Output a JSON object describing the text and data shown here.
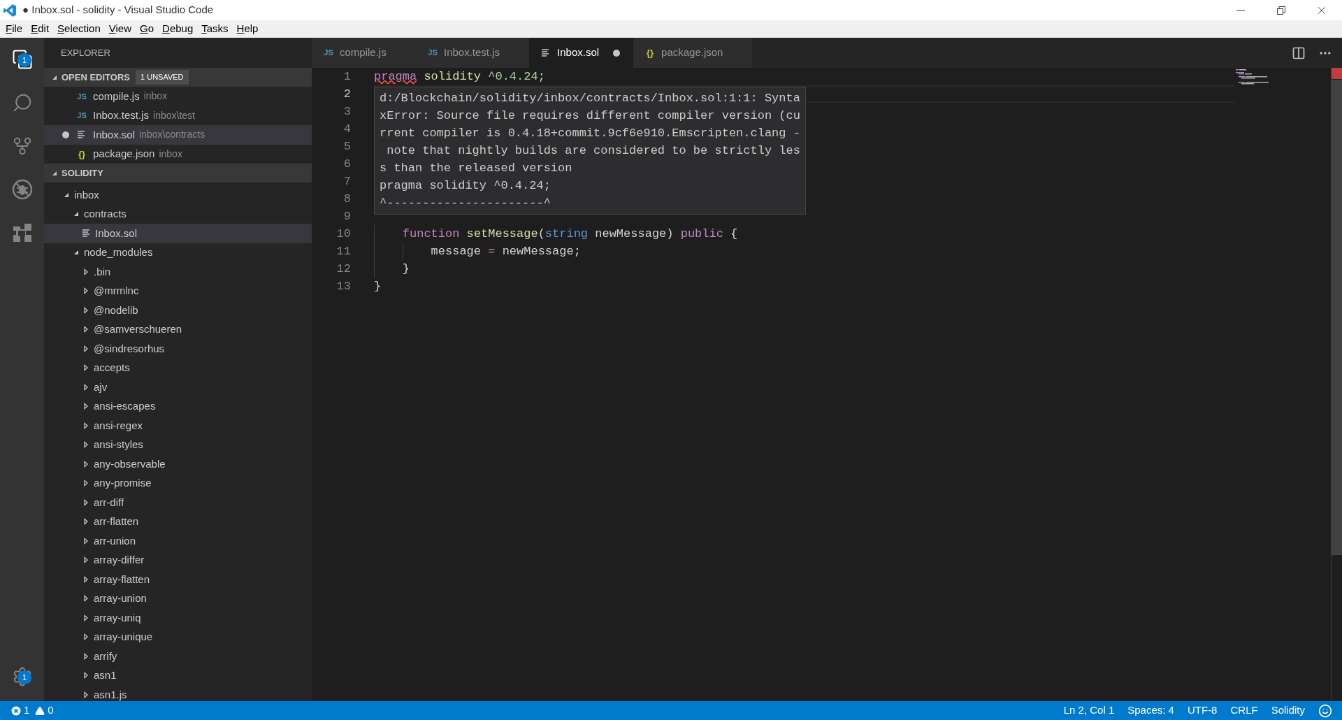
{
  "window": {
    "title": "● Inbox.sol - solidity - Visual Studio Code"
  },
  "menu": [
    "File",
    "Edit",
    "Selection",
    "View",
    "Go",
    "Debug",
    "Tasks",
    "Help"
  ],
  "activity_bar": [
    {
      "kind": "files",
      "selected": true,
      "badge": "1"
    },
    {
      "kind": "search",
      "selected": false
    },
    {
      "kind": "git",
      "selected": false
    },
    {
      "kind": "debug",
      "selected": false
    },
    {
      "kind": "extensions",
      "selected": false
    }
  ],
  "settings": {
    "badge": "1"
  },
  "sidebar": {
    "title": "EXPLORER",
    "open_editors": {
      "title": "OPEN EDITORS",
      "badge": "1 UNSAVED",
      "expanded": true,
      "items": [
        {
          "name": "compile.js",
          "folder": "inbox",
          "icon": {
            "kind": "js",
            "glyph": "JS"
          },
          "dirty": false,
          "selected": false
        },
        {
          "name": "Inbox.test.js",
          "folder": "inbox\\test",
          "icon": {
            "kind": "js",
            "glyph": "JS"
          },
          "dirty": false,
          "selected": false
        },
        {
          "name": "Inbox.sol",
          "folder": "inbox\\contracts",
          "icon": {
            "kind": "lines"
          },
          "dirty": true,
          "selected": true
        },
        {
          "name": "package.json",
          "folder": "inbox",
          "icon": {
            "kind": "json",
            "glyph": "{}"
          },
          "dirty": false,
          "selected": false
        }
      ]
    },
    "folder": {
      "title": "SOLIDITY",
      "expanded": true,
      "tree": [
        {
          "name": "inbox",
          "kind": "folder",
          "expanded": true,
          "selected": false,
          "children": [
            {
              "name": "contracts",
              "kind": "folder",
              "expanded": true,
              "selected": false,
              "children": [
                {
                  "name": "Inbox.sol",
                  "kind": "file",
                  "selected": true
                }
              ]
            },
            {
              "name": "node_modules",
              "kind": "folder",
              "expanded": true,
              "selected": false,
              "children": [
                {
                  "name": ".bin",
                  "kind": "folder",
                  "expanded": false,
                  "selected": false
                },
                {
                  "name": "@mrmlnc",
                  "kind": "folder",
                  "expanded": false,
                  "selected": false
                },
                {
                  "name": "@nodelib",
                  "kind": "folder",
                  "expanded": false,
                  "selected": false
                },
                {
                  "name": "@samverschueren",
                  "kind": "folder",
                  "expanded": false,
                  "selected": false
                },
                {
                  "name": "@sindresorhus",
                  "kind": "folder",
                  "expanded": false,
                  "selected": false
                },
                {
                  "name": "accepts",
                  "kind": "folder",
                  "expanded": false,
                  "selected": false
                },
                {
                  "name": "ajv",
                  "kind": "folder",
                  "expanded": false,
                  "selected": false
                },
                {
                  "name": "ansi-escapes",
                  "kind": "folder",
                  "expanded": false,
                  "selected": false
                },
                {
                  "name": "ansi-regex",
                  "kind": "folder",
                  "expanded": false,
                  "selected": false
                },
                {
                  "name": "ansi-styles",
                  "kind": "folder",
                  "expanded": false,
                  "selected": false
                },
                {
                  "name": "any-observable",
                  "kind": "folder",
                  "expanded": false,
                  "selected": false
                },
                {
                  "name": "any-promise",
                  "kind": "folder",
                  "expanded": false,
                  "selected": false
                },
                {
                  "name": "arr-diff",
                  "kind": "folder",
                  "expanded": false,
                  "selected": false
                },
                {
                  "name": "arr-flatten",
                  "kind": "folder",
                  "expanded": false,
                  "selected": false
                },
                {
                  "name": "arr-union",
                  "kind": "folder",
                  "expanded": false,
                  "selected": false
                },
                {
                  "name": "array-differ",
                  "kind": "folder",
                  "expanded": false,
                  "selected": false
                },
                {
                  "name": "array-flatten",
                  "kind": "folder",
                  "expanded": false,
                  "selected": false
                },
                {
                  "name": "array-union",
                  "kind": "folder",
                  "expanded": false,
                  "selected": false
                },
                {
                  "name": "array-uniq",
                  "kind": "folder",
                  "expanded": false,
                  "selected": false
                },
                {
                  "name": "array-unique",
                  "kind": "folder",
                  "expanded": false,
                  "selected": false
                },
                {
                  "name": "arrify",
                  "kind": "folder",
                  "expanded": false,
                  "selected": false
                },
                {
                  "name": "asn1",
                  "kind": "folder",
                  "expanded": false,
                  "selected": false
                },
                {
                  "name": "asn1.js",
                  "kind": "folder",
                  "expanded": false,
                  "selected": false
                }
              ]
            }
          ]
        }
      ]
    }
  },
  "tabs": [
    {
      "label": "compile.js",
      "icon": {
        "kind": "js",
        "glyph": "JS"
      },
      "selected": false,
      "dirty": false
    },
    {
      "label": "Inbox.test.js",
      "icon": {
        "kind": "js",
        "glyph": "JS"
      },
      "selected": false,
      "dirty": false
    },
    {
      "label": "Inbox.sol",
      "icon": {
        "kind": "lines"
      },
      "selected": true,
      "dirty": true
    },
    {
      "label": "package.json",
      "icon": {
        "kind": "json",
        "glyph": "{}"
      },
      "selected": false,
      "dirty": false
    }
  ],
  "editor": {
    "lines": [
      {
        "number": "1",
        "current": false,
        "tokens": [
          {
            "kind": "keyword",
            "text": "pragma",
            "error": true
          },
          {
            "kind": "name",
            "text": " solidity"
          },
          {
            "kind": "number",
            "text": " ^0.4.24"
          },
          {
            "kind": "plain",
            "text": ";"
          }
        ]
      },
      {
        "number": "2",
        "current": true
      },
      {
        "number": "3",
        "current": false
      },
      {
        "number": "4",
        "current": false
      },
      {
        "number": "5",
        "current": false
      },
      {
        "number": "6",
        "current": false
      },
      {
        "number": "7",
        "current": false
      },
      {
        "number": "8",
        "current": false
      },
      {
        "number": "9",
        "current": false
      },
      {
        "number": "10",
        "current": false,
        "tokens": [
          {
            "kind": "keyword",
            "text": "    function"
          },
          {
            "kind": "function",
            "text": " setMessage"
          },
          {
            "kind": "plain",
            "text": "("
          },
          {
            "kind": "type",
            "text": "string"
          },
          {
            "kind": "plain",
            "text": " newMessage) "
          },
          {
            "kind": "keyword",
            "text": "public"
          },
          {
            "kind": "plain",
            "text": " {"
          }
        ]
      },
      {
        "number": "11",
        "current": false,
        "tokens": [
          {
            "kind": "plain",
            "text": "        message "
          },
          {
            "kind": "keyword",
            "text": "="
          },
          {
            "kind": "plain",
            "text": " newMessage;"
          }
        ]
      },
      {
        "number": "12",
        "current": false,
        "tokens": [
          {
            "kind": "plain",
            "text": "    }"
          }
        ]
      },
      {
        "number": "13",
        "current": false,
        "tokens": [
          {
            "kind": "plain",
            "text": "}"
          }
        ]
      }
    ],
    "hover": [
      "d:/Blockchain/solidity/inbox/contracts/Inbox.sol:1:1: Synta",
      "xError: Source file requires different compiler version (cu",
      "rrent compiler is 0.4.18+commit.9cf6e910.Emscripten.clang -",
      " note that nightly builds are considered to be strictly les",
      "s than the released version",
      "pragma solidity ^0.4.24;",
      "^----------------------^"
    ]
  },
  "status_bar": {
    "errors": "1",
    "warnings": "0",
    "items": [
      "Ln 2, Col 1",
      "Spaces: 4",
      "UTF-8",
      "CRLF",
      "Solidity"
    ]
  }
}
